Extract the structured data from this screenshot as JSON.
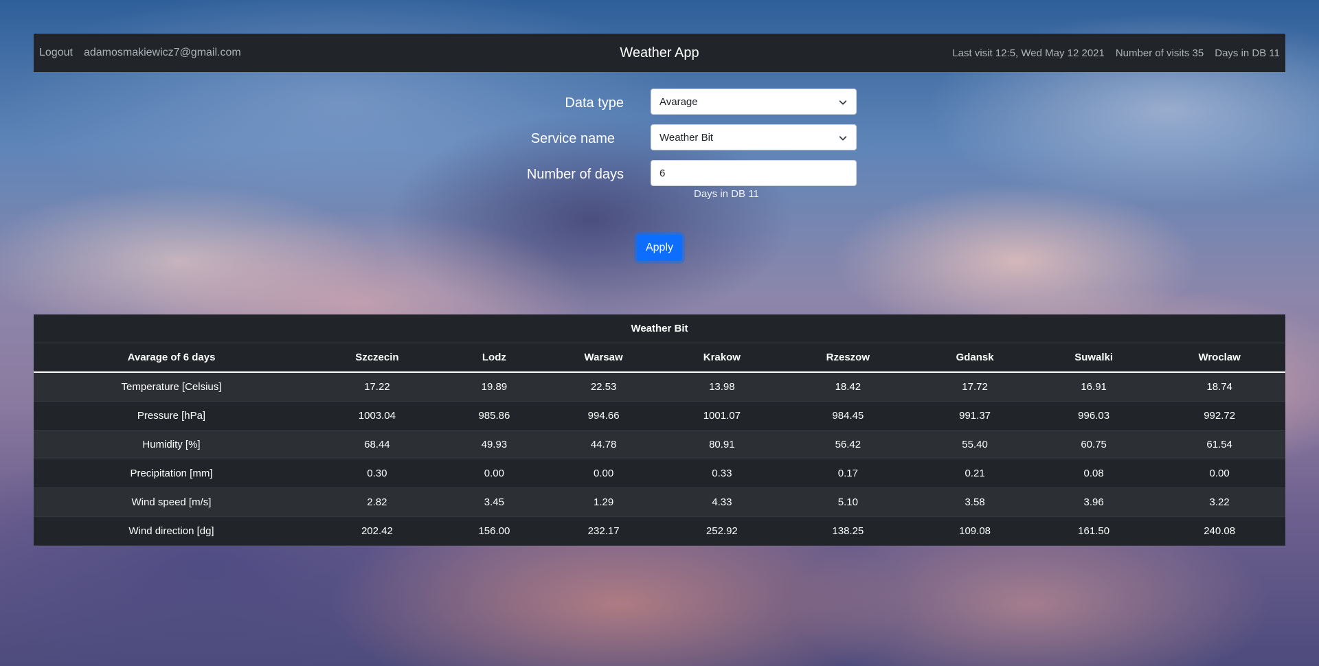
{
  "nav": {
    "logout": "Logout",
    "email": "adamosmakiewicz7@gmail.com",
    "title": "Weather App",
    "last_visit": "Last visit 12:5, Wed May 12 2021",
    "visits": "Number of visits 35",
    "days_in_db": "Days in DB 11"
  },
  "form": {
    "data_type_label": "Data type",
    "data_type_value": "Avarage",
    "service_label": "Service name",
    "service_value": "Weather Bit",
    "days_label": "Number of days",
    "days_value": "6",
    "hint": "Days in DB 11",
    "apply": "Apply"
  },
  "table": {
    "caption": "Weather Bit",
    "headers": [
      "Avarage of 6 days",
      "Szczecin",
      "Lodz",
      "Warsaw",
      "Krakow",
      "Rzeszow",
      "Gdansk",
      "Suwalki",
      "Wroclaw"
    ],
    "rows": [
      [
        "Temperature [Celsius]",
        "17.22",
        "19.89",
        "22.53",
        "13.98",
        "18.42",
        "17.72",
        "16.91",
        "18.74"
      ],
      [
        "Pressure [hPa]",
        "1003.04",
        "985.86",
        "994.66",
        "1001.07",
        "984.45",
        "991.37",
        "996.03",
        "992.72"
      ],
      [
        "Humidity [%]",
        "68.44",
        "49.93",
        "44.78",
        "80.91",
        "56.42",
        "55.40",
        "60.75",
        "61.54"
      ],
      [
        "Precipitation [mm]",
        "0.30",
        "0.00",
        "0.00",
        "0.33",
        "0.17",
        "0.21",
        "0.08",
        "0.00"
      ],
      [
        "Wind speed [m/s]",
        "2.82",
        "3.45",
        "1.29",
        "4.33",
        "5.10",
        "3.58",
        "3.96",
        "3.22"
      ],
      [
        "Wind direction [dg]",
        "202.42",
        "156.00",
        "232.17",
        "252.92",
        "138.25",
        "109.08",
        "161.50",
        "240.08"
      ]
    ]
  },
  "colors": {
    "navbar": "#212529",
    "primary": "#0d6efd",
    "table_bg": "#212529",
    "table_stripe": "#2c3034"
  }
}
